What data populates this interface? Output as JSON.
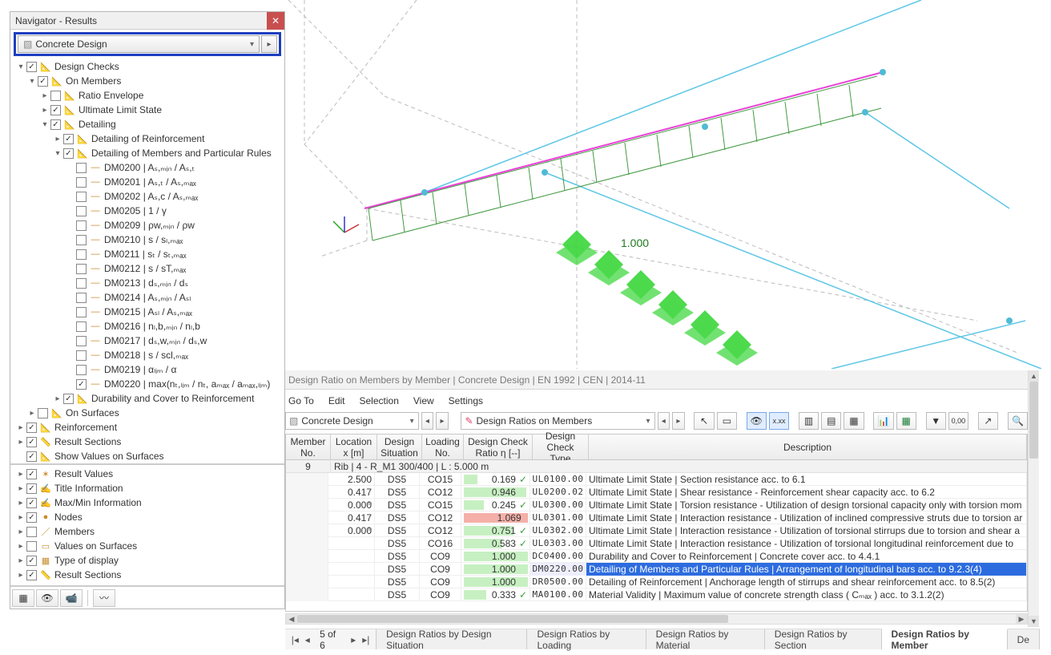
{
  "navigator": {
    "title": "Navigator - Results",
    "combo": "Concrete Design",
    "tree": [
      {
        "lvl": 0,
        "tw": "▾",
        "cb": "checked",
        "ic": "📐",
        "label": "Design Checks"
      },
      {
        "lvl": 1,
        "tw": "▾",
        "cb": "checked",
        "ic": "📐",
        "label": "On Members"
      },
      {
        "lvl": 2,
        "tw": "▸",
        "cb": "",
        "ic": "📐",
        "label": "Ratio Envelope"
      },
      {
        "lvl": 2,
        "tw": "▸",
        "cb": "checked",
        "ic": "📐",
        "label": "Ultimate Limit State"
      },
      {
        "lvl": 2,
        "tw": "▾",
        "cb": "checked",
        "ic": "📐",
        "label": "Detailing"
      },
      {
        "lvl": 3,
        "tw": "▸",
        "cb": "checked",
        "ic": "📐",
        "label": "Detailing of Reinforcement"
      },
      {
        "lvl": 3,
        "tw": "▾",
        "cb": "checked",
        "ic": "📐",
        "label": "Detailing of Members and Particular Rules"
      },
      {
        "lvl": 4,
        "tw": "",
        "cb": "",
        "ic": "—",
        "label": "DM0200 | Aₛ,ₘᵢₙ / Aₛ,ₜ"
      },
      {
        "lvl": 4,
        "tw": "",
        "cb": "",
        "ic": "—",
        "label": "DM0201 | Aₛ,ₜ / Aₛ,ₘₐₓ"
      },
      {
        "lvl": 4,
        "tw": "",
        "cb": "",
        "ic": "—",
        "label": "DM0202 | Aₛ,c / Aₛ,ₘₐₓ"
      },
      {
        "lvl": 4,
        "tw": "",
        "cb": "",
        "ic": "—",
        "label": "DM0205 | 1 / γ"
      },
      {
        "lvl": 4,
        "tw": "",
        "cb": "",
        "ic": "—",
        "label": "DM0209 | ρw,ₘᵢₙ / ρw"
      },
      {
        "lvl": 4,
        "tw": "",
        "cb": "",
        "ic": "—",
        "label": "DM0210 | s / sₗ,ₘₐₓ"
      },
      {
        "lvl": 4,
        "tw": "",
        "cb": "",
        "ic": "—",
        "label": "DM0211 | sₜ / sₜ,ₘₐₓ"
      },
      {
        "lvl": 4,
        "tw": "",
        "cb": "",
        "ic": "—",
        "label": "DM0212 | s / sT,ₘₐₓ"
      },
      {
        "lvl": 4,
        "tw": "",
        "cb": "",
        "ic": "—",
        "label": "DM0213 | dₛ,ₘᵢₙ / dₛ"
      },
      {
        "lvl": 4,
        "tw": "",
        "cb": "",
        "ic": "—",
        "label": "DM0214 | Aₛ,ₘᵢₙ / Aₛₗ"
      },
      {
        "lvl": 4,
        "tw": "",
        "cb": "",
        "ic": "—",
        "label": "DM0215 | Aₛₗ / Aₛ,ₘₐₓ"
      },
      {
        "lvl": 4,
        "tw": "",
        "cb": "",
        "ic": "—",
        "label": "DM0216 | nₗ,b,ₘᵢₙ / nₗ,b"
      },
      {
        "lvl": 4,
        "tw": "",
        "cb": "",
        "ic": "—",
        "label": "DM0217 | dₛ,w,ₘᵢₙ / dₛ,w"
      },
      {
        "lvl": 4,
        "tw": "",
        "cb": "",
        "ic": "—",
        "label": "DM0218 | s / scl,ₘₐₓ"
      },
      {
        "lvl": 4,
        "tw": "",
        "cb": "",
        "ic": "—",
        "label": "DM0219 | αₗᵢₘ / α"
      },
      {
        "lvl": 4,
        "tw": "",
        "cb": "checked",
        "ic": "—",
        "label": "DM0220 | max(nₜ,ₗᵢₘ / nₜ, aₘₐₓ / aₘₐₓ,ₗᵢₘ)"
      },
      {
        "lvl": 3,
        "tw": "▸",
        "cb": "checked",
        "ic": "📐",
        "label": "Durability and Cover to Reinforcement"
      },
      {
        "lvl": 1,
        "tw": "▸",
        "cb": "",
        "ic": "📐",
        "label": "On Surfaces"
      },
      {
        "lvl": 0,
        "tw": "▸",
        "cb": "checked",
        "ic": "📐",
        "label": "Reinforcement"
      },
      {
        "lvl": 0,
        "tw": "▸",
        "cb": "checked",
        "ic": "📏",
        "label": "Result Sections"
      },
      {
        "lvl": 0,
        "tw": "",
        "cb": "checked",
        "ic": "📐",
        "label": "Show Values on Surfaces"
      }
    ],
    "tree2": [
      {
        "lvl": 0,
        "tw": "▸",
        "cb": "checked",
        "ic": "✶",
        "label": "Result Values"
      },
      {
        "lvl": 0,
        "tw": "▸",
        "cb": "checked",
        "ic": "✍",
        "label": "Title Information"
      },
      {
        "lvl": 0,
        "tw": "▸",
        "cb": "checked",
        "ic": "✍",
        "label": "Max/Min Information"
      },
      {
        "lvl": 0,
        "tw": "▸",
        "cb": "checked",
        "ic": "●",
        "label": "Nodes"
      },
      {
        "lvl": 0,
        "tw": "▸",
        "cb": "",
        "ic": "／",
        "label": "Members"
      },
      {
        "lvl": 0,
        "tw": "▸",
        "cb": "",
        "ic": "▭",
        "label": "Values on Surfaces"
      },
      {
        "lvl": 0,
        "tw": "▸",
        "cb": "checked",
        "ic": "▦",
        "label": "Type of display"
      },
      {
        "lvl": 0,
        "tw": "▸",
        "cb": "checked",
        "ic": "📏",
        "label": "Result Sections"
      }
    ],
    "bottom_icons": [
      "▦",
      "👁",
      "📹",
      "〰"
    ]
  },
  "viewport": {
    "annotation": "1.000"
  },
  "results": {
    "title": "Design Ratio on Members by Member | Concrete Design | EN 1992 | CEN | 2014-11",
    "menu": [
      "Go To",
      "Edit",
      "Selection",
      "View",
      "Settings"
    ],
    "combo1": "Concrete Design",
    "combo2": "Design Ratios on Members",
    "headers": {
      "member_no": "Member\nNo.",
      "location": "Location\nx [m]",
      "design_sit": "Design\nSituation",
      "loading": "Loading\nNo.",
      "ratio": "Design Check\nRatio η [--]",
      "type": "Design Check\nType",
      "desc": "Description"
    },
    "group": {
      "mno": "9",
      "text": "Rib | 4 - R_M1 300/400 | L : 5.000 m"
    },
    "rows": [
      {
        "loc": "2.500",
        "anch": "",
        "ds": "DS5",
        "load": "CO15",
        "bar": 17,
        "barcls": "",
        "ratio": "0.169",
        "mark": "✓",
        "type": "UL0100.00",
        "desc": "Ultimate Limit State | Section resistance acc. to 6.1",
        "sel": false
      },
      {
        "loc": "0.417",
        "anch": "",
        "ds": "DS5",
        "load": "CO12",
        "bar": 78,
        "barcls": "",
        "ratio": "0.946",
        "mark": "✓",
        "type": "UL0200.02",
        "desc": "Ultimate Limit State | Shear resistance - Reinforcement shear capacity acc. to 6.2",
        "sel": false
      },
      {
        "loc": "0.000",
        "anch": "≐",
        "ds": "DS5",
        "load": "CO15",
        "bar": 25,
        "barcls": "",
        "ratio": "0.245",
        "mark": "✓",
        "type": "UL0300.00",
        "desc": "Ultimate Limit State | Torsion resistance - Utilization of design torsional capacity only with torsion mom",
        "sel": false
      },
      {
        "loc": "0.417",
        "anch": "",
        "ds": "DS5",
        "load": "CO12",
        "bar": 80,
        "barcls": "red",
        "ratio": "1.069",
        "mark": "!",
        "type": "UL0301.00",
        "desc": "Ultimate Limit State | Interaction resistance - Utilization of inclined compressive struts due to torsion ar",
        "sel": false
      },
      {
        "loc": "0.000",
        "anch": "≐",
        "ds": "DS5",
        "load": "CO12",
        "bar": 62,
        "barcls": "",
        "ratio": "0.751",
        "mark": "✓",
        "type": "UL0302.00",
        "desc": "Ultimate Limit State | Interaction resistance - Utilization of torsional stirrups due to torsion and shear a",
        "sel": false
      },
      {
        "loc": "",
        "anch": "",
        "ds": "DS5",
        "load": "CO16",
        "bar": 48,
        "barcls": "",
        "ratio": "0.583",
        "mark": "✓",
        "type": "UL0303.00",
        "desc": "Ultimate Limit State | Interaction resistance - Utilization of torsional longitudinal reinforcement due to ",
        "sel": false
      },
      {
        "loc": "",
        "anch": "",
        "ds": "DS5",
        "load": "CO9",
        "bar": 80,
        "barcls": "",
        "ratio": "1.000",
        "mark": "✓",
        "type": "DC0400.00",
        "desc": "Durability and Cover to Reinforcement | Concrete cover acc. to 4.4.1",
        "sel": false
      },
      {
        "loc": "",
        "anch": "",
        "ds": "DS5",
        "load": "CO9",
        "bar": 80,
        "barcls": "",
        "ratio": "1.000",
        "mark": "✓",
        "type": "DM0220.00",
        "desc": "Detailing of Members and Particular Rules | Arrangement of longitudinal bars acc. to 9.2.3(4)",
        "sel": true
      },
      {
        "loc": "",
        "anch": "",
        "ds": "DS5",
        "load": "CO9",
        "bar": 80,
        "barcls": "",
        "ratio": "1.000",
        "mark": "✓",
        "type": "DR0500.00",
        "desc": "Detailing of Reinforcement | Anchorage length of stirrups and shear reinforcement acc. to 8.5(2)",
        "sel": false
      },
      {
        "loc": "",
        "anch": "",
        "ds": "DS5",
        "load": "CO9",
        "bar": 28,
        "barcls": "",
        "ratio": "0.333",
        "mark": "✓",
        "type": "MA0100.00",
        "desc": "Material Validity | Maximum value of concrete strength class ( Cₘₐₓ ) acc. to 3.1.2(2)",
        "sel": false
      }
    ],
    "pager": "5 of 6",
    "tabs": [
      "Design Ratios by Design Situation",
      "Design Ratios by Loading",
      "Design Ratios by Material",
      "Design Ratios by Section",
      "Design Ratios by Member",
      "De"
    ],
    "active_tab": 4
  }
}
